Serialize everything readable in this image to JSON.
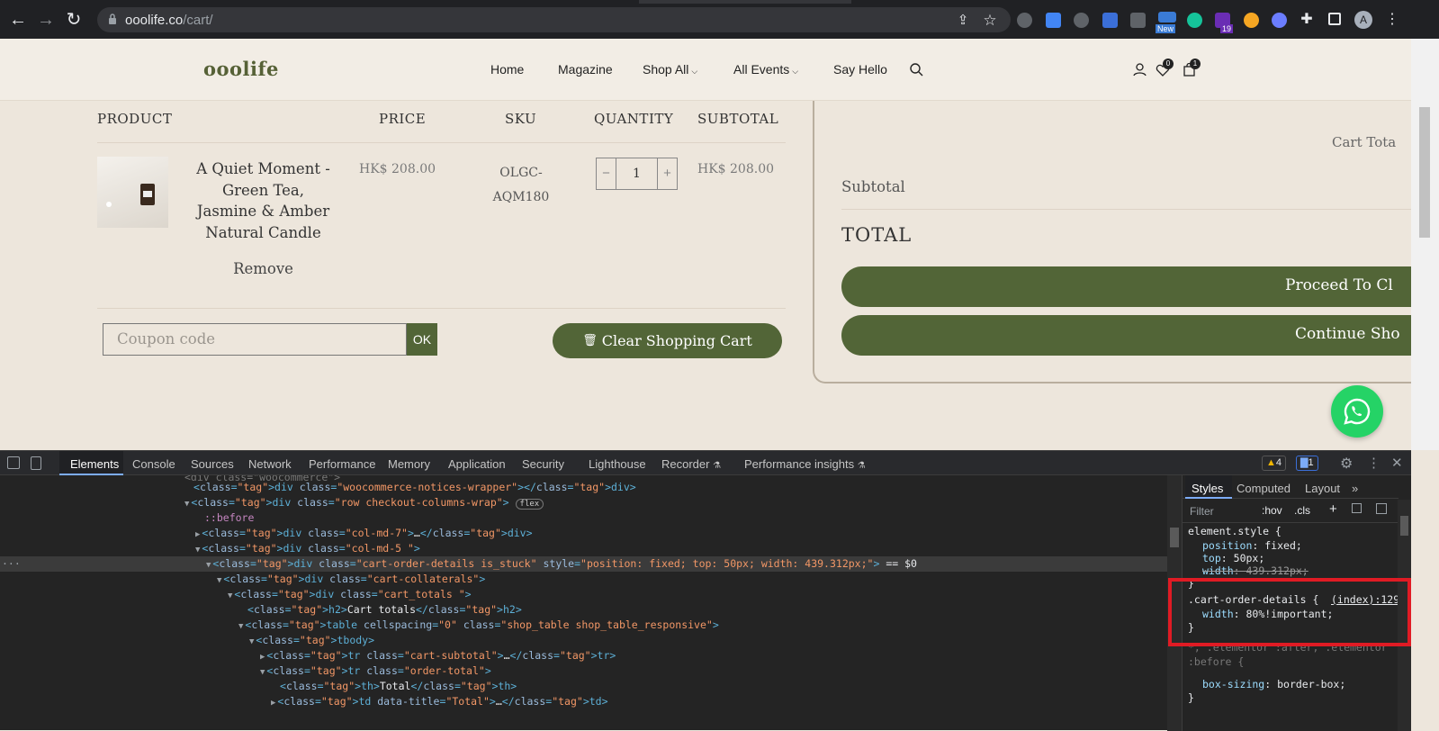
{
  "browser": {
    "url_host": "ooolife.co",
    "url_path": "/cart/",
    "ext_badge_new": "New",
    "ext_badge_count": "19",
    "profile_initial": "A"
  },
  "site": {
    "logo": "ooolife",
    "nav": [
      "Home",
      "Magazine",
      "Shop All",
      "All Events",
      "Say Hello"
    ],
    "wishlist_count": "0",
    "cart_count": "1"
  },
  "cart": {
    "headers": {
      "product": "PRODUCT",
      "price": "PRICE",
      "sku": "SKU",
      "quantity": "QUANTITY",
      "subtotal": "SUBTOTAL"
    },
    "item": {
      "name_lines": [
        "A Quiet Moment -",
        "Green Tea,",
        "Jasmine & Amber",
        "Natural Candle"
      ],
      "price": "HK$ 208.00",
      "sku_lines": [
        "OLGC-",
        "AQM180"
      ],
      "quantity": "1",
      "subtotal": "HK$ 208.00",
      "remove": "Remove",
      "minus": "−",
      "plus": "+"
    },
    "coupon_placeholder": "Coupon code",
    "ok_label": "OK",
    "clear_label": "Clear Shopping Cart"
  },
  "totals": {
    "title": "Cart Tota",
    "subtotal_label": "Subtotal",
    "total_label": "TOTAL",
    "proceed_label": "Proceed To Cl",
    "continue_label": "Continue Sho"
  },
  "devtools": {
    "tabs": [
      "Elements",
      "Console",
      "Sources",
      "Network",
      "Performance",
      "Memory",
      "Application",
      "Security",
      "Lighthouse",
      "Recorder",
      "Performance insights"
    ],
    "warn_count": "4",
    "msg_count": "1",
    "dom_lines": [
      {
        "indent": 0,
        "arrow": "",
        "html": "<div class=\"woocommerce-notices-wrapper\"></div>"
      },
      {
        "indent": 0,
        "arrow": "▼",
        "html": "<div class=\"row checkout-columns-wrap\">",
        "badge": "flex"
      },
      {
        "indent": 1,
        "arrow": "",
        "html": "::before"
      },
      {
        "indent": 1,
        "arrow": "▶",
        "html": "<div class=\"col-md-7\">…</div>"
      },
      {
        "indent": 1,
        "arrow": "▼",
        "html": "<div class=\"col-md-5 \">"
      },
      {
        "indent": 2,
        "arrow": "▼",
        "html": "<div class=\"cart-order-details is_stuck\" style=\"position: fixed; top: 50px; width: 439.312px;\"> == $0",
        "selected": true
      },
      {
        "indent": 3,
        "arrow": "▼",
        "html": "<div class=\"cart-collaterals\">"
      },
      {
        "indent": 4,
        "arrow": "▼",
        "html": "<div class=\"cart_totals \">"
      },
      {
        "indent": 5,
        "arrow": "",
        "html": "<h2>Cart totals</h2>"
      },
      {
        "indent": 5,
        "arrow": "▼",
        "html": "<table cellspacing=\"0\" class=\"shop_table shop_table_responsive\">"
      },
      {
        "indent": 6,
        "arrow": "▼",
        "html": "<tbody>"
      },
      {
        "indent": 7,
        "arrow": "▶",
        "html": "<tr class=\"cart-subtotal\">…</tr>"
      },
      {
        "indent": 7,
        "arrow": "▼",
        "html": "<tr class=\"order-total\">"
      },
      {
        "indent": 8,
        "arrow": "",
        "html": "<th>Total</th>"
      },
      {
        "indent": 8,
        "arrow": "▶",
        "html": "<td data-title=\"Total\">…</td>"
      }
    ],
    "styles_tabs": [
      "Styles",
      "Computed",
      "Layout"
    ],
    "filter_placeholder": "Filter",
    "hov": ":hov",
    "cls": ".cls",
    "rules": {
      "element_style_selector": "element.style {",
      "el_props": [
        [
          "position",
          "fixed;"
        ],
        [
          "top",
          "50px;"
        ],
        [
          "width",
          "439.312px;"
        ]
      ],
      "cart_selector": ".cart-order-details {",
      "cart_source": "(index):129",
      "cart_prop": [
        "width",
        "80%!important;"
      ],
      "elementor_selector": "*, .elementor :after, .elementor :before {",
      "elementor_prop": [
        "box-sizing",
        "border-box;"
      ],
      "close_brace": "}"
    }
  },
  "colors": {
    "brand_green": "#526537",
    "highlight_red": "#e01b24"
  }
}
